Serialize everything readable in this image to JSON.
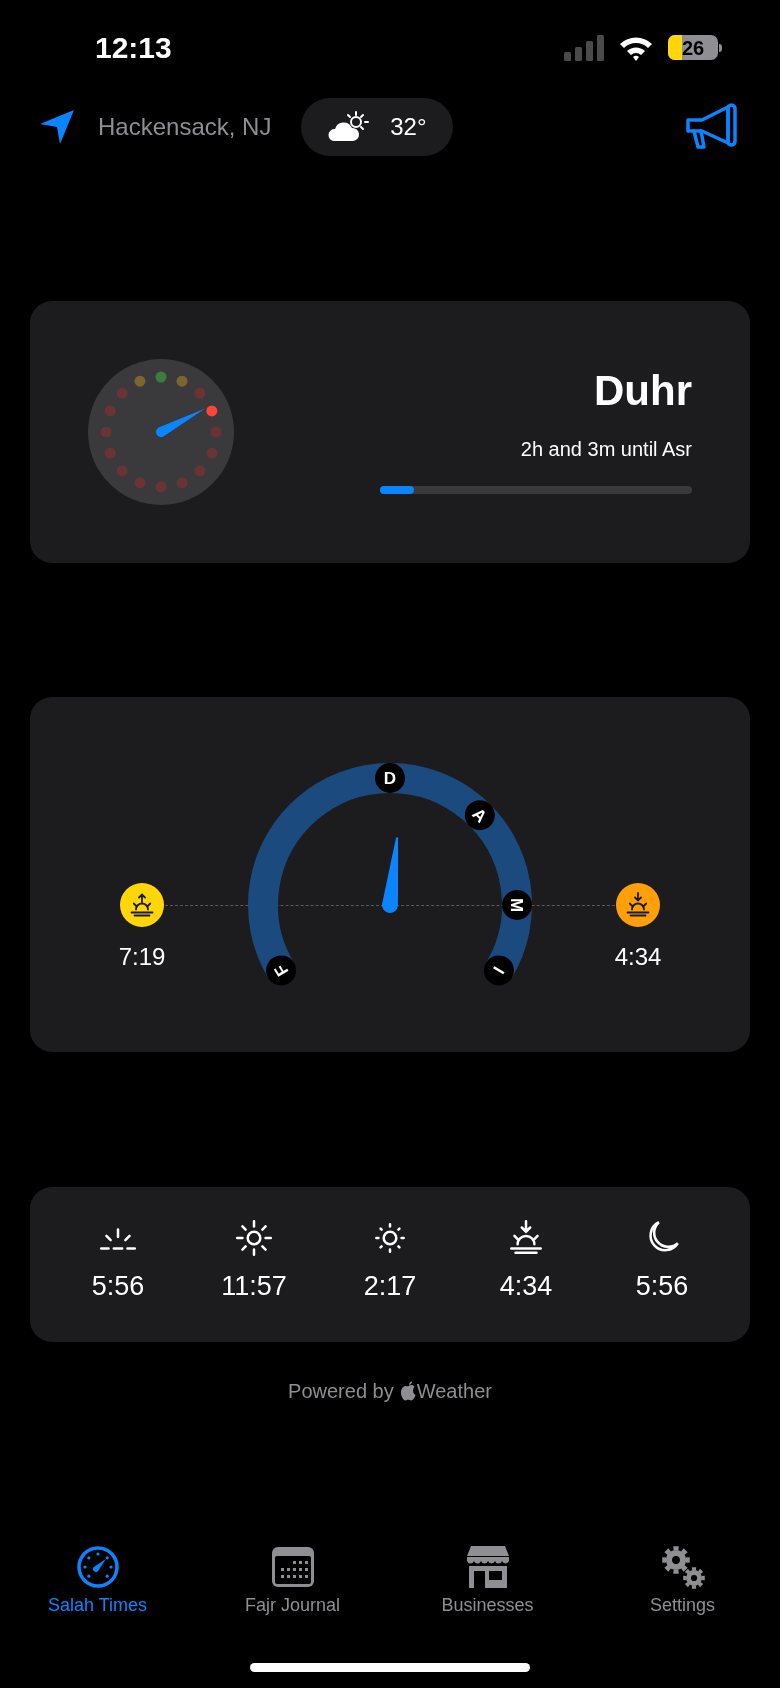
{
  "status_bar": {
    "time": "12:13",
    "battery": "26"
  },
  "header": {
    "location": "Hackensack, NJ",
    "temperature": "32°"
  },
  "current_prayer": {
    "name": "Duhr",
    "countdown": "2h and 3m until Asr",
    "level": 0.11,
    "dial_markers": [
      {
        "color": "#3f7a3f"
      },
      {
        "color": "#7d6530"
      },
      {
        "color": "#6b3434"
      },
      {
        "color": "#ff453a"
      },
      {
        "color": "#6b3434"
      },
      {
        "color": "#6b3434"
      },
      {
        "color": "#6b3434"
      },
      {
        "color": "#6b3434"
      },
      {
        "color": "#6b3434"
      },
      {
        "color": "#6b3434"
      },
      {
        "color": "#6b3434"
      },
      {
        "color": "#6b3434"
      },
      {
        "color": "#6b3434"
      },
      {
        "color": "#6b3434"
      },
      {
        "color": "#6b3434"
      },
      {
        "color": "#7d6530"
      }
    ]
  },
  "sun_gauge": {
    "markers": [
      {
        "label": "F"
      },
      {
        "label": "D"
      },
      {
        "label": "A"
      },
      {
        "label": "M"
      },
      {
        "label": "I"
      }
    ],
    "ends": [
      {
        "kind": "sunrise",
        "time": "7:19"
      },
      {
        "kind": "sunset",
        "time": "4:34"
      }
    ]
  },
  "prayer_times": [
    {
      "kind": "dawn",
      "time": "5:56"
    },
    {
      "kind": "sun",
      "time": "11:57"
    },
    {
      "kind": "sun-small",
      "time": "2:17"
    },
    {
      "kind": "sunset",
      "time": "4:34"
    },
    {
      "kind": "moon",
      "time": "5:56"
    }
  ],
  "powered_by": {
    "prefix": "Powered by",
    "suffix": "Weather"
  },
  "tabs": [
    {
      "kind": "gauge",
      "label": "Salah Times",
      "selected": true
    },
    {
      "kind": "calendar",
      "label": "Fajr Journal",
      "selected": false
    },
    {
      "kind": "store",
      "label": "Businesses",
      "selected": false
    },
    {
      "kind": "gears",
      "label": "Settings",
      "selected": false
    }
  ]
}
